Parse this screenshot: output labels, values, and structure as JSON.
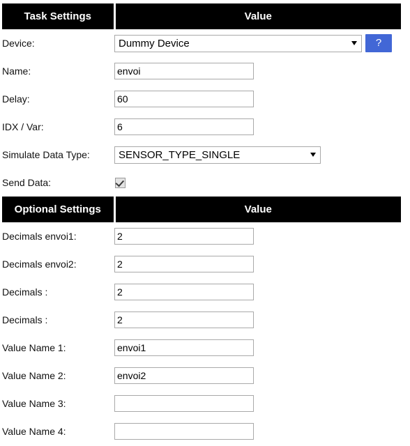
{
  "task_section": {
    "header": {
      "label_col": "Task Settings",
      "value_col": "Value"
    },
    "rows": [
      {
        "label": "Device:",
        "control": "select",
        "value": "Dummy Device",
        "caret": "chevron-down-icon",
        "help_label": "?"
      },
      {
        "label": "Name:",
        "control": "text",
        "value": "envoi",
        "placeholder": ""
      },
      {
        "label": "Delay:",
        "control": "text",
        "value": "60",
        "placeholder": ""
      },
      {
        "label": "IDX / Var:",
        "control": "text",
        "value": "6",
        "placeholder": ""
      },
      {
        "label": "Simulate Data Type:",
        "control": "select",
        "value": "SENSOR_TYPE_SINGLE",
        "caret": "chevron-down-icon"
      },
      {
        "label": "Send Data:",
        "control": "checkbox",
        "checked": true
      }
    ]
  },
  "optional_section": {
    "header": {
      "label_col": "Optional Settings",
      "value_col": "Value"
    },
    "rows": [
      {
        "label": "Decimals envoi1:",
        "control": "text",
        "value": "2",
        "placeholder": ""
      },
      {
        "label": "Decimals envoi2:",
        "control": "text",
        "value": "2",
        "placeholder": ""
      },
      {
        "label": "Decimals :",
        "control": "text",
        "value": "2",
        "placeholder": ""
      },
      {
        "label": "Decimals :",
        "control": "text",
        "value": "2",
        "placeholder": ""
      },
      {
        "label": "Value Name 1:",
        "control": "text",
        "value": "envoi1",
        "placeholder": ""
      },
      {
        "label": "Value Name 2:",
        "control": "text",
        "value": "envoi2",
        "placeholder": ""
      },
      {
        "label": "Value Name 3:",
        "control": "text",
        "value": "",
        "placeholder": ""
      },
      {
        "label": "Value Name 4:",
        "control": "text",
        "value": "",
        "placeholder": ""
      }
    ]
  },
  "colors": {
    "header_bg": "#000000",
    "header_text": "#ffffff",
    "help_button_bg": "#4267d6",
    "input_border": "#a9a9a9",
    "page_bg": "#ffffff"
  }
}
